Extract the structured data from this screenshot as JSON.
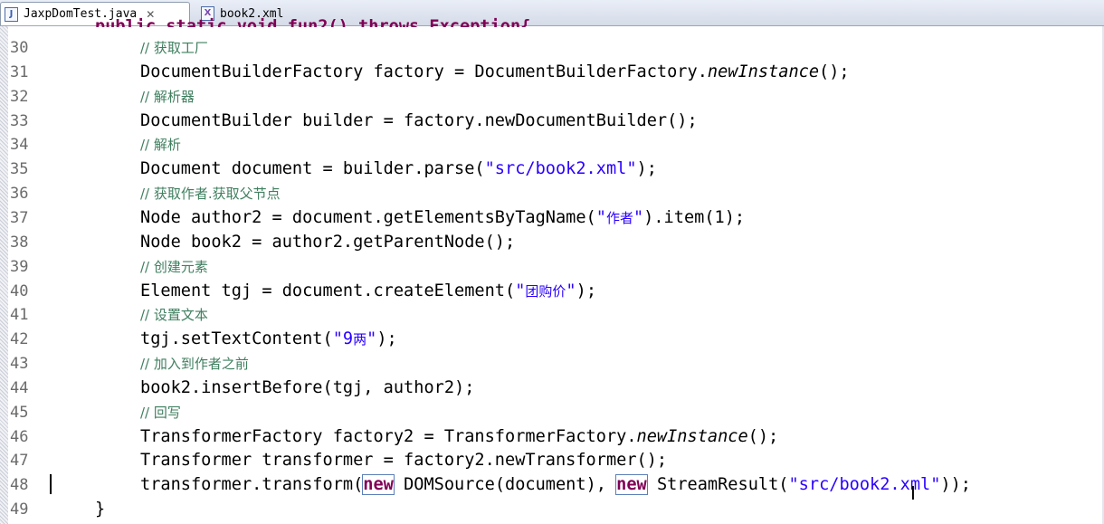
{
  "tabs": [
    {
      "label": "JaxpDomTest.java",
      "icon": "java-file-icon",
      "active": true
    },
    {
      "label": "book2.xml",
      "icon": "xml-file-icon",
      "active": false
    }
  ],
  "top_partial_line": "public static void fun2() throws Exception{",
  "lines": [
    {
      "n": "30",
      "parts": [
        {
          "t": "// 获取工厂",
          "c": "cm"
        }
      ]
    },
    {
      "n": "31",
      "parts": [
        {
          "t": "DocumentBuilderFactory factory = DocumentBuilderFactory.",
          "c": ""
        },
        {
          "t": "newInstance",
          "c": "it"
        },
        {
          "t": "();",
          "c": ""
        }
      ]
    },
    {
      "n": "32",
      "parts": [
        {
          "t": "// 解析器",
          "c": "cm"
        }
      ]
    },
    {
      "n": "33",
      "parts": [
        {
          "t": "DocumentBuilder builder = factory.newDocumentBuilder();",
          "c": ""
        }
      ]
    },
    {
      "n": "34",
      "parts": [
        {
          "t": "// 解析",
          "c": "cm"
        }
      ]
    },
    {
      "n": "35",
      "parts": [
        {
          "t": "Document document = builder.parse(",
          "c": ""
        },
        {
          "t": "\"src/book2.xml\"",
          "c": "str"
        },
        {
          "t": ");",
          "c": ""
        }
      ]
    },
    {
      "n": "36",
      "parts": [
        {
          "t": "// 获取作者.获取父节点",
          "c": "cm"
        }
      ]
    },
    {
      "n": "37",
      "parts": [
        {
          "t": "Node author2 = document.getElementsByTagName(",
          "c": ""
        },
        {
          "t": "\"",
          "c": "str"
        },
        {
          "t": "作者",
          "c": "str cn"
        },
        {
          "t": "\"",
          "c": "str"
        },
        {
          "t": ").item(1);",
          "c": ""
        }
      ]
    },
    {
      "n": "38",
      "parts": [
        {
          "t": "Node book2 = author2.getParentNode();",
          "c": ""
        }
      ]
    },
    {
      "n": "39",
      "parts": [
        {
          "t": "// 创建元素",
          "c": "cm"
        }
      ]
    },
    {
      "n": "40",
      "parts": [
        {
          "t": "Element tgj = document.createElement(",
          "c": ""
        },
        {
          "t": "\"",
          "c": "str"
        },
        {
          "t": "团购价",
          "c": "str cn"
        },
        {
          "t": "\"",
          "c": "str"
        },
        {
          "t": ");",
          "c": ""
        }
      ]
    },
    {
      "n": "41",
      "parts": [
        {
          "t": "// 设置文本",
          "c": "cm"
        }
      ]
    },
    {
      "n": "42",
      "parts": [
        {
          "t": "tgj.setTextContent(",
          "c": ""
        },
        {
          "t": "\"9",
          "c": "str"
        },
        {
          "t": "两",
          "c": "str cn"
        },
        {
          "t": "\"",
          "c": "str"
        },
        {
          "t": ");",
          "c": ""
        }
      ]
    },
    {
      "n": "43",
      "parts": [
        {
          "t": "// 加入到作者之前",
          "c": "cm"
        }
      ]
    },
    {
      "n": "44",
      "parts": [
        {
          "t": "book2.insertBefore(tgj, author2);",
          "c": ""
        }
      ]
    },
    {
      "n": "45",
      "parts": [
        {
          "t": "// 回写",
          "c": "cm"
        }
      ]
    },
    {
      "n": "46",
      "parts": [
        {
          "t": "TransformerFactory factory2 = TransformerFactory.",
          "c": ""
        },
        {
          "t": "newInstance",
          "c": "it"
        },
        {
          "t": "();",
          "c": ""
        }
      ]
    },
    {
      "n": "47",
      "parts": [
        {
          "t": "Transformer transformer = factory2.newTransformer();",
          "c": ""
        }
      ]
    },
    {
      "n": "48",
      "parts": [
        {
          "t": "transformer.transform(",
          "c": ""
        },
        {
          "t": "new",
          "c": "kw box"
        },
        {
          "t": " DOMSource(document)",
          "c": ""
        },
        {
          "t": ", ",
          "c": ""
        },
        {
          "t": "new",
          "c": "kw box"
        },
        {
          "t": " StreamResult(",
          "c": ""
        },
        {
          "t": "\"src/book2.xml\"",
          "c": "str"
        },
        {
          "t": "));",
          "c": ""
        }
      ]
    },
    {
      "n": "49",
      "parts": [
        {
          "t": "}",
          "c": ""
        }
      ]
    }
  ]
}
